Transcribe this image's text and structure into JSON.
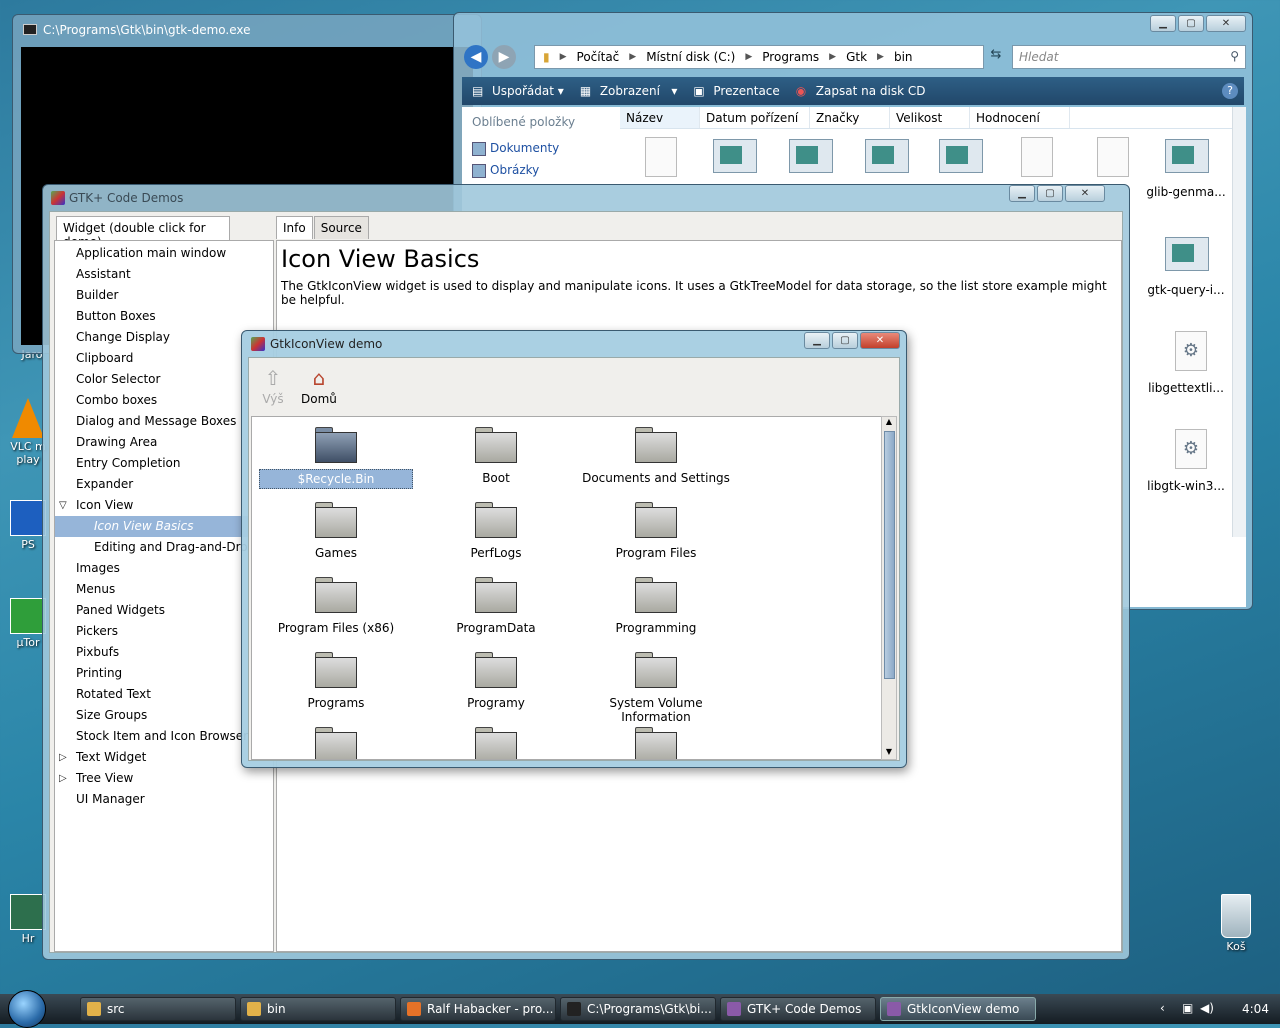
{
  "desktop": {
    "icons": [
      {
        "label": "VLC m\nplay",
        "name": "vlc"
      },
      {
        "label": "PS",
        "name": "ps"
      },
      {
        "label": "µTor",
        "name": "utorrent"
      },
      {
        "label": "Hr",
        "name": "hr"
      },
      {
        "label": "Koš",
        "name": "recycle-bin"
      },
      {
        "label": "Jaro",
        "name": "jaro"
      }
    ]
  },
  "console": {
    "title": "C:\\Programs\\Gtk\\bin\\gtk-demo.exe"
  },
  "explorer": {
    "breadcrumbs": [
      "Počítač",
      "Místní disk (C:)",
      "Programs",
      "Gtk",
      "bin"
    ],
    "search_placeholder": "Hledat",
    "toolbar": [
      "Uspořádat",
      "Zobrazení",
      "Prezentace",
      "Zapsat na disk CD"
    ],
    "help": "?",
    "nav_header": "Oblíbené položky",
    "nav_items": [
      "Dokumenty",
      "Obrázky"
    ],
    "columns": [
      "Název",
      "Datum pořízení",
      "Značky",
      "Velikost",
      "Hodnocení"
    ],
    "files": [
      {
        "label": "glib-genma...",
        "icon": "app-icon"
      },
      {
        "label": "gtk-query-i...",
        "icon": "app-icon"
      },
      {
        "label": "libgettextli...",
        "icon": "dll-icon"
      },
      {
        "label": "libgtk-win3...",
        "icon": "dll-icon"
      }
    ]
  },
  "gtkdemo": {
    "title": "GTK+ Code Demos",
    "left_tab": "Widget (double click for demo)",
    "tabs": [
      "Info",
      "Source"
    ],
    "tree": [
      {
        "label": "Application main window"
      },
      {
        "label": "Assistant"
      },
      {
        "label": "Builder"
      },
      {
        "label": "Button Boxes"
      },
      {
        "label": "Change Display"
      },
      {
        "label": "Clipboard"
      },
      {
        "label": "Color Selector"
      },
      {
        "label": "Combo boxes"
      },
      {
        "label": "Dialog and Message Boxes"
      },
      {
        "label": "Drawing Area"
      },
      {
        "label": "Entry Completion"
      },
      {
        "label": "Expander"
      },
      {
        "label": "Icon View",
        "expander": "expanded"
      },
      {
        "label": "Icon View Basics",
        "child": true,
        "selected": true
      },
      {
        "label": "Editing and Drag-and-Drop",
        "child": true
      },
      {
        "label": "Images"
      },
      {
        "label": "Menus"
      },
      {
        "label": "Paned Widgets"
      },
      {
        "label": "Pickers"
      },
      {
        "label": "Pixbufs"
      },
      {
        "label": "Printing"
      },
      {
        "label": "Rotated Text"
      },
      {
        "label": "Size Groups"
      },
      {
        "label": "Stock Item and Icon Browser"
      },
      {
        "label": "Text Widget",
        "expander": "collapsed"
      },
      {
        "label": "Tree View",
        "expander": "collapsed"
      },
      {
        "label": "UI Manager"
      }
    ],
    "info_heading": "Icon View Basics",
    "info_text": "The GtkIconView widget is used to display and manipulate icons. It uses a GtkTreeModel for data storage, so the list store example might be helpful."
  },
  "iconview": {
    "title": "GtkIconView demo",
    "up_label": "Výš",
    "home_label": "Domů",
    "folders": [
      {
        "label": "$Recycle.Bin",
        "selected": true
      },
      {
        "label": "Boot"
      },
      {
        "label": "Documents and Settings"
      },
      {
        "label": "Games"
      },
      {
        "label": "PerfLogs"
      },
      {
        "label": "Program Files"
      },
      {
        "label": "Program Files (x86)"
      },
      {
        "label": "ProgramData"
      },
      {
        "label": "Programming"
      },
      {
        "label": "Programs"
      },
      {
        "label": "Programy"
      },
      {
        "label": "System Volume Information"
      },
      {
        "label": ""
      },
      {
        "label": ""
      },
      {
        "label": ""
      }
    ]
  },
  "taskbar": {
    "buttons": [
      {
        "label": "src",
        "icon": "folder-icon"
      },
      {
        "label": "bin",
        "icon": "folder-icon"
      },
      {
        "label": "Ralf Habacker - pro...",
        "icon": "firefox-icon"
      },
      {
        "label": "C:\\Programs\\Gtk\\bi...",
        "icon": "console-icon"
      },
      {
        "label": "GTK+ Code Demos",
        "icon": "gtk-icon"
      },
      {
        "label": "GtkIconView demo",
        "icon": "gtk-icon",
        "active": true
      }
    ],
    "clock": "4:04"
  }
}
